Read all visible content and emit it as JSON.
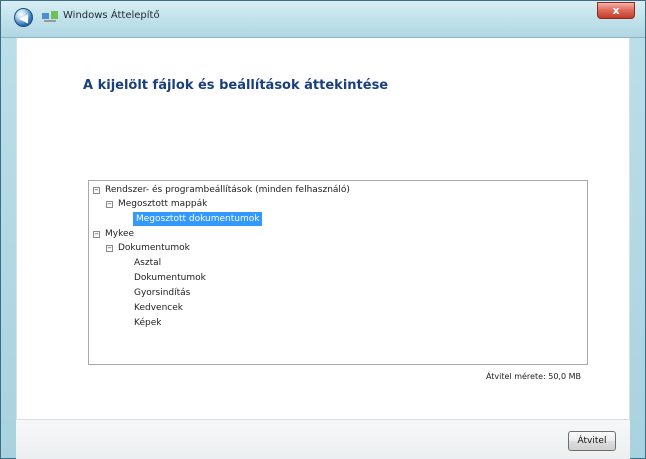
{
  "window": {
    "title": "Windows Áttelepítő",
    "close_label": "x"
  },
  "navigation": {
    "back_icon": "back-arrow-icon",
    "app_icon": "windows-transfer-icon",
    "close_icon": "close-icon"
  },
  "page": {
    "heading": "A kijelölt fájlok és beállítások áttekintése"
  },
  "tree": {
    "items": [
      {
        "label": "Rendszer- és programbeállítások (minden felhasználó)",
        "expanded": true,
        "selected": false
      },
      {
        "label": "Megosztott mappák",
        "expanded": true,
        "selected": false
      },
      {
        "label": "Megosztott dokumentumok",
        "expanded": false,
        "selected": true
      },
      {
        "label": "Mykee",
        "expanded": true,
        "selected": false
      },
      {
        "label": "Dokumentumok",
        "expanded": true,
        "selected": false
      },
      {
        "label": "Asztal",
        "expanded": false,
        "selected": false
      },
      {
        "label": "Dokumentumok",
        "expanded": false,
        "selected": false
      },
      {
        "label": "Gyorsindítás",
        "expanded": false,
        "selected": false
      },
      {
        "label": "Kedvencek",
        "expanded": false,
        "selected": false
      },
      {
        "label": "Képek",
        "expanded": false,
        "selected": false
      }
    ],
    "expander_symbol": "−"
  },
  "summary": {
    "transfer_size": "Átvitel mérete: 50,0 MB"
  },
  "actions": {
    "transfer_button": "Átvitel"
  },
  "colors": {
    "heading": "#1b3f7b",
    "selection": "#3399ff",
    "chrome": "#bde0ea"
  }
}
